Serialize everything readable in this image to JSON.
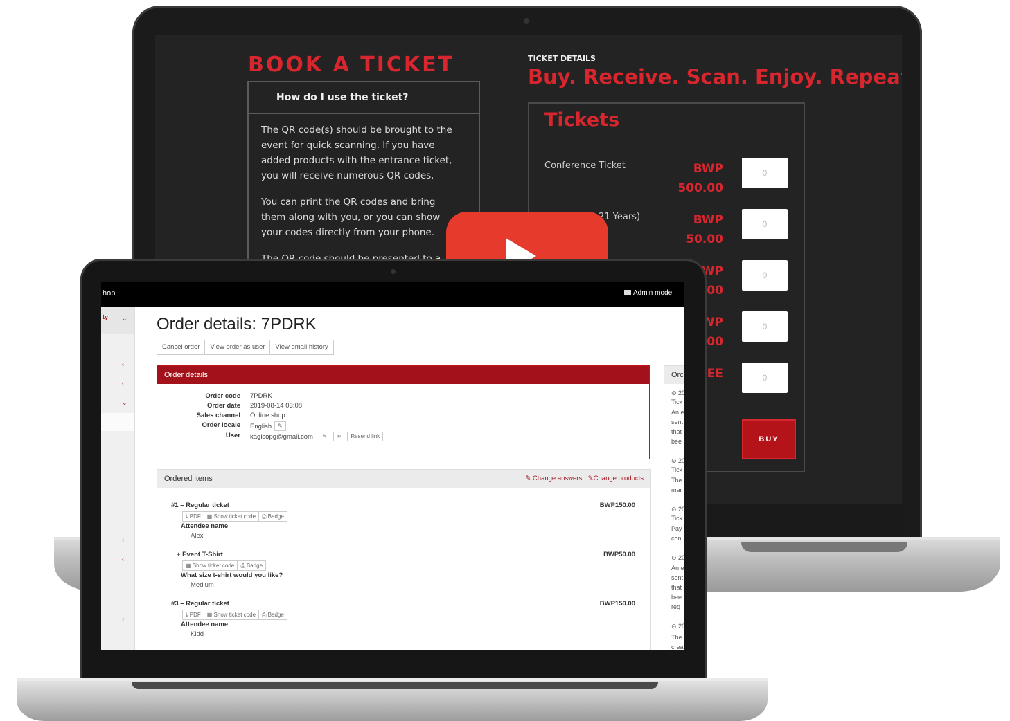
{
  "back_screen": {
    "book_title": "BOOK A TICKET",
    "faq_question": "How do I use the ticket?",
    "faq_paragraphs": [
      "The QR code(s) should be brought to the event for quick scanning. If you have added products with the entrance ticket, you will receive numerous QR codes.",
      "You can print the QR codes and bring them along with you, or you can show your codes directly from your phone.",
      "The QR code should be presented to a"
    ],
    "details_label": "TICKET DETAILS",
    "slogan": "Buy. Receive. Scan. Enjoy. Repeat.",
    "tickets_title": "Tickets",
    "tickets": [
      {
        "name": "Conference Ticket",
        "currency": "BWP",
        "amount": "500.00",
        "qty": "0"
      },
      {
        "name": "21 Years)",
        "currency": "BWP",
        "amount": "50.00",
        "qty": "0"
      },
      {
        "name": "",
        "currency": "WP",
        "amount": "00",
        "qty": "0"
      },
      {
        "name": "",
        "currency": "WP",
        "amount": "00",
        "qty": "0"
      },
      {
        "name": "",
        "currency": "EE",
        "amount": "",
        "qty": "0"
      }
    ],
    "buy_label": "BUY",
    "play_button": "play-icon"
  },
  "front_screen": {
    "topbar_shop": "hop",
    "admin_mode": "Admin mode",
    "sidebar_top": "ty",
    "page_title": "Order details: 7PDRK",
    "action_buttons": [
      "Cancel order",
      "View order as user",
      "View email history"
    ],
    "order_panel": {
      "heading": "Order details",
      "rows": [
        {
          "key": "Order code",
          "value": "7PDRK"
        },
        {
          "key": "Order date",
          "value": "2019-08-14 03:08"
        },
        {
          "key": "Sales channel",
          "value": "Online shop"
        },
        {
          "key": "Order locale",
          "value": "English"
        },
        {
          "key": "User",
          "value": "kagisopg@gmail.com"
        }
      ],
      "resend_link": "Resend link"
    },
    "items_panel": {
      "heading": "Ordered items",
      "change_answers": "Change answers",
      "separator": "·",
      "change_products": "Change products",
      "items": [
        {
          "title": "#1 – Regular ticket",
          "price": "BWP150.00",
          "buttons": [
            "PDF",
            "Show ticket code",
            "Badge"
          ],
          "question": "Attendee name",
          "answer": "Alex"
        },
        {
          "title": "+ Event T-Shirt",
          "price": "BWP50.00",
          "buttons": [
            "Show ticket code",
            "Badge"
          ],
          "question": "What size t-shirt would you like?",
          "answer": "Medium"
        },
        {
          "title": "#3 – Regular ticket",
          "price": "BWP150.00",
          "buttons": [
            "PDF",
            "Show ticket code",
            "Badge"
          ],
          "question": "Attendee name",
          "answer": "Kidd"
        }
      ]
    },
    "right_panel": {
      "heading": "Orc",
      "lines": [
        "⊙ 20",
        "Tick",
        "An e",
        "sent",
        "that",
        "bee",
        "⊙ 20",
        "Tick",
        "The",
        "mar",
        "⊙ 20",
        "Tick",
        "Pay",
        "con",
        "⊙ 20",
        "An e",
        "sent",
        "that",
        "bee",
        "req",
        "⊙ 20",
        "The",
        "crea"
      ]
    }
  }
}
